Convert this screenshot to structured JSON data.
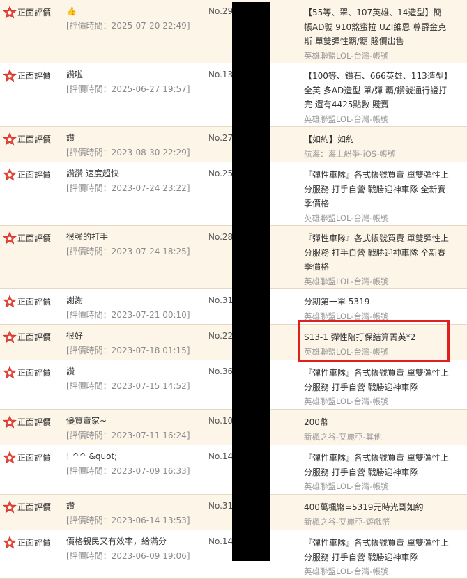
{
  "rating_label": "正面評價",
  "colors": {
    "star": "#e8473a",
    "highlight": "#e02020",
    "redaction": "#000000"
  },
  "reviews": [
    {
      "rating": "正面評價",
      "comment": "👍",
      "time": "[評價時間：2025-07-20 22:49]",
      "order_no": "No.29",
      "product_title": "【55等、翠、107英雄、14造型】簡帳AD號 910煞蜜拉 UZI維恩 尊爵金克斯 單雙彈性覇/覇 賤價出售",
      "category": "英雄聯盟LOL-台灣-帳號"
    },
    {
      "rating": "正面評價",
      "comment": "讚啦",
      "time": "[評價時間：2025-06-27 19:57]",
      "order_no": "No.13",
      "product_title": "【100等、鑽石、666英雄、113造型】全英 多AD造型 單/彈 覇/鑽號通行證打完 還有4425點數 賤賣",
      "category": "英雄聯盟LOL-台灣-帳號"
    },
    {
      "rating": "正面評價",
      "comment": "讚",
      "time": "[評價時間：2023-08-30 22:29]",
      "order_no": "No.27",
      "product_title": "【如約】如約",
      "category": "航海：海上紛爭-iOS-帳號"
    },
    {
      "rating": "正面評價",
      "comment": "讚讚 速度超快",
      "time": "[評價時間：2023-07-24 23:22]",
      "order_no": "No.25",
      "product_title": "『彈性車隊』各式帳號買賣 單雙彈性上分服務 打手自營 戰勝迎神車隊 全新賽季價格",
      "category": "英雄聯盟LOL-台灣-帳號"
    },
    {
      "rating": "正面評價",
      "comment": "很強的打手",
      "time": "[評價時間：2023-07-24 18:25]",
      "order_no": "No.28",
      "product_title": "『彈性車隊』各式帳號買賣 單雙彈性上分服務 打手自營 戰勝迎神車隊 全新賽季價格",
      "category": "英雄聯盟LOL-台灣-帳號"
    },
    {
      "rating": "正面評價",
      "comment": "謝謝",
      "time": "[評價時間：2023-07-21 00:10]",
      "order_no": "No.31",
      "product_title": "分期第一單 5319",
      "category": "英雄聯盟LOL-台灣-帳號"
    },
    {
      "rating": "正面評價",
      "comment": "很好",
      "time": "[評價時間：2023-07-18 01:15]",
      "order_no": "No.22",
      "product_title": "S13-1 彈性陪打保結算菁英*2",
      "category": "英雄聯盟LOL-台灣-帳號"
    },
    {
      "rating": "正面評價",
      "comment": "讚",
      "time": "[評價時間：2023-07-15 14:52]",
      "order_no": "No.36",
      "product_title": "『彈性車隊』各式帳號買賣 單雙彈性上分服務 打手自營 戰勝迎神車隊",
      "category": "英雄聯盟LOL-台灣-帳號"
    },
    {
      "rating": "正面評價",
      "comment": "優質賣家~",
      "time": "[評價時間：2023-07-11 16:24]",
      "order_no": "No.10",
      "product_title": "200幣",
      "category": "新楓之谷-艾麗亞-其他"
    },
    {
      "rating": "正面評價",
      "comment": "! ^^ &quot;",
      "time": "[評價時間：2023-07-09 16:33]",
      "order_no": "No.14",
      "product_title": "『彈性車隊』各式帳號買賣 單雙彈性上分服務 打手自營 戰勝迎神車隊",
      "category": "英雄聯盟LOL-台灣-帳號"
    },
    {
      "rating": "正面評價",
      "comment": "讚",
      "time": "[評價時間：2023-06-14 13:53]",
      "order_no": "No.31",
      "product_title": "400萬楓幣=5319元時光哥如約",
      "category": "新楓之谷-艾麗亞-遊戲幣"
    },
    {
      "rating": "正面評價",
      "comment": "價格親民又有效率，給滿分",
      "time": "[評價時間：2023-06-09 19:06]",
      "order_no": "No.14",
      "product_title": "『彈性車隊』各式帳號買賣 單雙彈性上分服務 打手自營 戰勝迎神車隊",
      "category": "英雄聯盟LOL-台灣-帳號"
    }
  ]
}
